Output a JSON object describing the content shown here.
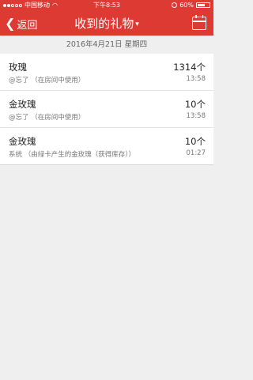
{
  "status_bar": {
    "carrier": "中国移动",
    "time": "下午8:53",
    "battery": "60%",
    "battery_level": 0.6
  },
  "nav": {
    "back_label": "返回",
    "title": "收到的礼物",
    "title_arrow": "▾"
  },
  "date_header": "2016年4月21日 星期四",
  "items": [
    {
      "name": "玫瑰",
      "sub": "@忘了 （在房间中使用）",
      "count": "1314个",
      "time": "13:58"
    },
    {
      "name": "金玫瑰",
      "sub": "@忘了 （在房间中使用）",
      "count": "10个",
      "time": "13:58"
    },
    {
      "name": "金玫瑰",
      "sub": "系统 （由绿卡产生的金玫瑰（获得库存））",
      "count": "10个",
      "time": "01:27"
    }
  ],
  "colors": {
    "header_bg": "#de3a34",
    "page_bg": "#efefef"
  }
}
